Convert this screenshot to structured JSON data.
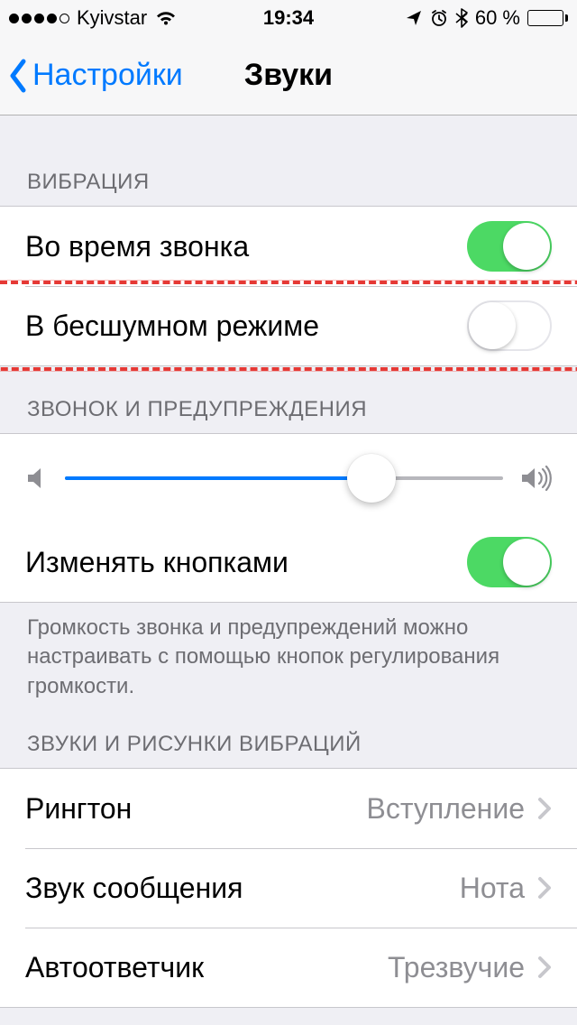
{
  "status": {
    "carrier": "Kyivstar",
    "time": "19:34",
    "battery_pct": "60 %",
    "signal_filled": 4,
    "signal_total": 5
  },
  "nav": {
    "back_label": "Настройки",
    "title": "Звуки"
  },
  "sections": {
    "vibration": {
      "header": "ВИБРАЦИЯ",
      "rows": {
        "on_ring": {
          "label": "Во время звонка",
          "on": true
        },
        "on_silent": {
          "label": "В бесшумном режиме",
          "on": false,
          "highlighted": true
        }
      }
    },
    "ringer": {
      "header": "ЗВОНОК И ПРЕДУПРЕЖДЕНИЯ",
      "volume_pct": 70,
      "change_with_buttons": {
        "label": "Изменять кнопками",
        "on": true
      },
      "footer": "Громкость звонка и предупреждений можно настраивать с помощью кнопок регулирования громкости."
    },
    "patterns": {
      "header": "ЗВУКИ И РИСУНКИ ВИБРАЦИЙ",
      "rows": [
        {
          "label": "Рингтон",
          "value": "Вступление"
        },
        {
          "label": "Звук сообщения",
          "value": "Нота"
        },
        {
          "label": "Автоответчик",
          "value": "Трезвучие"
        }
      ]
    }
  }
}
